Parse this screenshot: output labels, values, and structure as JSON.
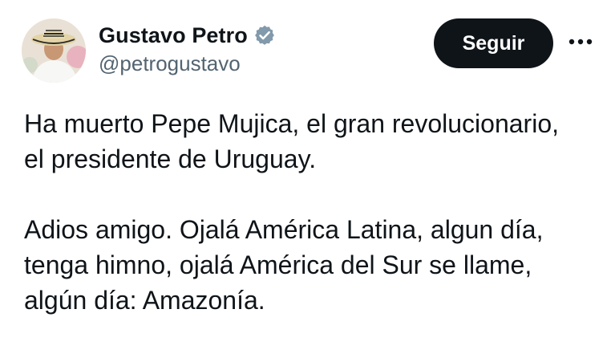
{
  "author": {
    "display_name": "Gustavo Petro",
    "handle": "@petrogustavo",
    "verified": true
  },
  "actions": {
    "follow_label": "Seguir",
    "more_icon": "more-horizontal-icon"
  },
  "tweet": {
    "paragraphs": [
      [
        "Ha muerto Pepe Mujica, el gran revolucionario,",
        "el presidente de Uruguay."
      ],
      [
        "Adios amigo. Ojalá América Latina, algun día,",
        "tenga himno, ojalá América del Sur se llame,",
        "algún día: Amazonía."
      ]
    ]
  },
  "colors": {
    "text": "#0f1419",
    "secondary_text": "#536471",
    "follow_button_bg": "#0f1419",
    "follow_button_text": "#ffffff",
    "verified_badge": "#829aab"
  }
}
